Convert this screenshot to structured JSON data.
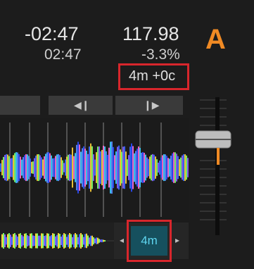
{
  "deck": {
    "letter": "A",
    "accent_color": "#f08a24"
  },
  "time": {
    "remaining": "-02:47",
    "elapsed": "02:47"
  },
  "tempo": {
    "bpm": "117.98",
    "pitch": "-3.3%"
  },
  "phase_offset": "4m +0c",
  "transport": {
    "prev_icon": "skip-back-icon",
    "next_icon": "skip-forward-icon"
  },
  "zoom": {
    "value": "4m",
    "decrease_icon": "triangle-left-icon",
    "increase_icon": "triangle-right-icon"
  },
  "highlight_color": "#d8262c"
}
